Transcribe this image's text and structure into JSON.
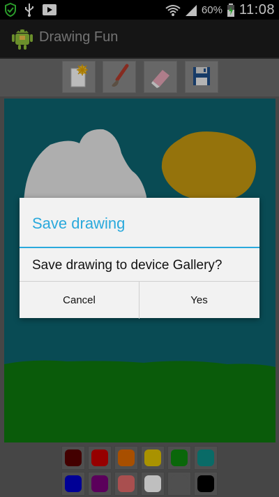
{
  "status_bar": {
    "battery_percent": "60%",
    "time": "11:08"
  },
  "action_bar": {
    "title": "Drawing Fun",
    "icon": "android-app-icon"
  },
  "toolbar": {
    "tools": [
      {
        "name": "new-drawing",
        "icon": "new-page-icon"
      },
      {
        "name": "brush",
        "icon": "brush-icon"
      },
      {
        "name": "eraser",
        "icon": "eraser-icon"
      },
      {
        "name": "save",
        "icon": "save-disk-icon"
      }
    ]
  },
  "canvas": {
    "background_color": "#0d6471",
    "sun_color": "#c79a10",
    "cloud_color": "#e8e8e8",
    "grass_color": "#0e7a0e"
  },
  "palette": {
    "colors": [
      "#5a0000",
      "#c80000",
      "#e06a00",
      "#e2c300",
      "#0e8a0e",
      "#0c8f8a",
      "#0000c8",
      "#7a007a",
      "#e26a6a",
      "#ffffff",
      "#6a6a6a",
      "#000000"
    ]
  },
  "dialog": {
    "title": "Save drawing",
    "message": "Save drawing to device Gallery?",
    "cancel_label": "Cancel",
    "yes_label": "Yes"
  }
}
